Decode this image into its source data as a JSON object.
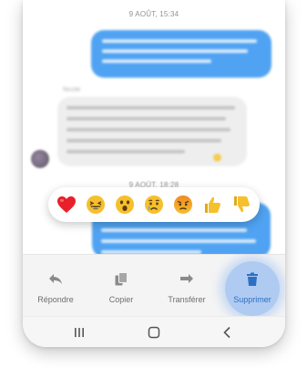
{
  "chat": {
    "timestamp_1": "9 AOÛT, 15:34",
    "timestamp_2": "9 AOÛT, 18:28",
    "sender_name": "Nicole"
  },
  "reactions": [
    {
      "icon": "red-heart-emoji",
      "color": "#e8202a"
    },
    {
      "icon": "laughing-emoji",
      "color": "#f5c02c"
    },
    {
      "icon": "surprised-emoji",
      "color": "#f5c02c"
    },
    {
      "icon": "crying-emoji",
      "color": "#f5c02c"
    },
    {
      "icon": "angry-emoji",
      "color": "#f5a623"
    },
    {
      "icon": "thumbs-up-emoji",
      "color": "#f5c02c"
    },
    {
      "icon": "thumbs-down-emoji",
      "color": "#f5c02c"
    }
  ],
  "actions": {
    "reply": {
      "label": "Répondre",
      "icon": "reply-arrow-icon"
    },
    "copy": {
      "label": "Copier",
      "icon": "copy-icon"
    },
    "forward": {
      "label": "Transférer",
      "icon": "forward-arrow-icon"
    },
    "delete": {
      "label": "Supprimer",
      "icon": "trash-icon"
    }
  },
  "navbar": {
    "recent": "recent-apps-icon",
    "home": "home-icon",
    "back": "back-icon"
  },
  "colors": {
    "outgoing_bubble": "#2a8ff0",
    "incoming_bubble": "#ebebeb",
    "highlight": "#78aaf0"
  }
}
